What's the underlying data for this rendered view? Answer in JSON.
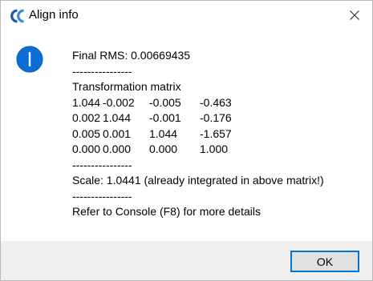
{
  "window": {
    "title": "Align info",
    "app_icon": "cloudcompare-logo",
    "close_icon": "close-icon"
  },
  "message": {
    "icon": "info-icon",
    "final_rms": "Final RMS: 0.00669435",
    "separator_1": "----------------",
    "matrix_title": "Transformation matrix",
    "matrix": [
      [
        "1.044",
        "-0.002",
        "-0.005",
        "-0.463"
      ],
      [
        "0.002",
        "1.044",
        "-0.001",
        "-0.176"
      ],
      [
        "0.005",
        "0.001",
        "1.044",
        "-1.657"
      ],
      [
        "0.000",
        "0.000",
        "0.000",
        "1.000"
      ]
    ],
    "separator_2": "----------------",
    "scale": "Scale: 1.0441 (already integrated in above matrix!)",
    "separator_3": "----------------",
    "console_hint": "Refer to Console (F8) for more details"
  },
  "buttons": {
    "ok_label": "OK"
  },
  "colors": {
    "info_blue": "#0a6fd1",
    "accent": "#0078d7",
    "footer_bg": "#f0f0f0"
  }
}
